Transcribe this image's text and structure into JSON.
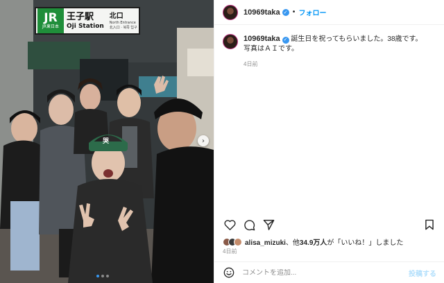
{
  "photo": {
    "station_sign": {
      "logo_text": "JR",
      "logo_sub": "JR東日本",
      "station_jp": "王子駅",
      "station_en": "Oji Station",
      "exit_jp": "北口",
      "exit_en": "North Entrance",
      "exit_sub": "北入口 · 북쪽 입구"
    },
    "cap_text": "哭",
    "carousel": {
      "next_icon": "chevron-right-icon",
      "slides": 3,
      "active_index": 0
    }
  },
  "post_header": {
    "username": "10969taka",
    "verified_icon": "verified-badge-icon",
    "separator": "•",
    "follow_label": "フォロー"
  },
  "caption": {
    "username": "10969taka",
    "line1": "誕生日を祝ってもらいました。38歳です。",
    "line2": "写真はＡＩです。",
    "time": "4日前"
  },
  "actions": {
    "like_icon": "heart-icon",
    "comment_icon": "comment-icon",
    "share_icon": "send-icon",
    "save_icon": "bookmark-icon"
  },
  "likes": {
    "liker": "alisa_mizuki",
    "mid": "、他",
    "count": "34.9万人",
    "suffix": "が「いいね！」しました"
  },
  "post_time": "4日前",
  "comment": {
    "emoji_icon": "smiley-icon",
    "placeholder": "コメントを追加...",
    "post_label": "投稿する"
  },
  "colors": {
    "accent_blue": "#0095f6",
    "post_disabled": "#b2dffc",
    "jr_green": "#1f8e3a",
    "muted": "#8e8e8e"
  }
}
